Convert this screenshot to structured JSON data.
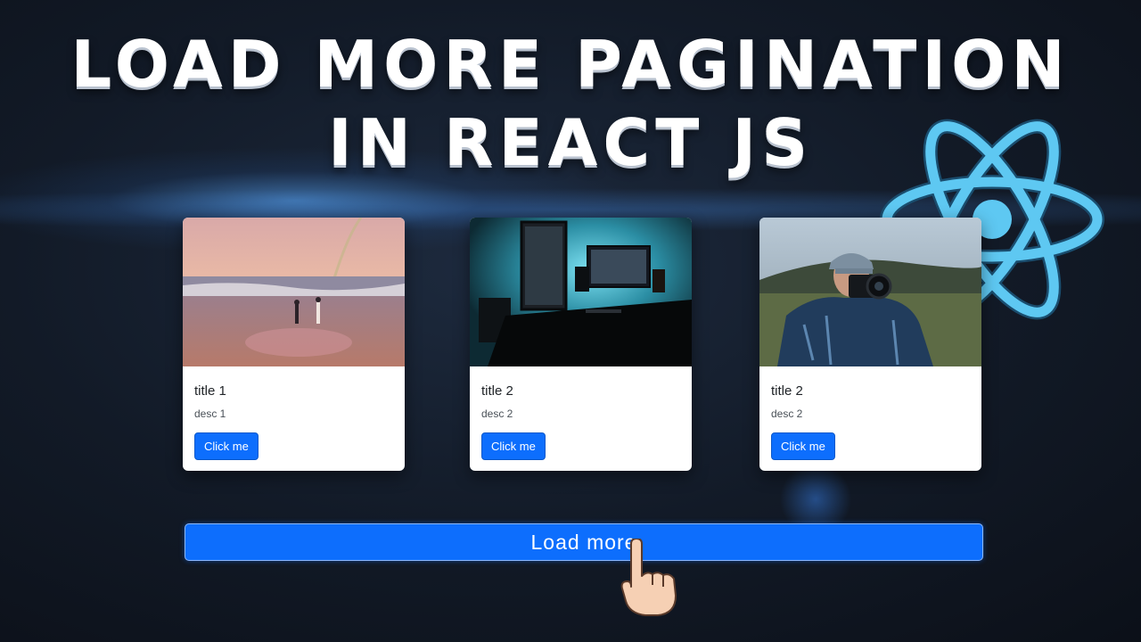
{
  "headline": {
    "line1": "LOAD MORE PAGINATION",
    "line2": "IN REACT JS"
  },
  "cards": [
    {
      "title": "title 1",
      "desc": "desc 1",
      "button_label": "Click me",
      "image": "beach-sunset-couple-photo"
    },
    {
      "title": "title 2",
      "desc": "desc 2",
      "button_label": "Click me",
      "image": "desk-monitor-setup-photo"
    },
    {
      "title": "title 2",
      "desc": "desc 2",
      "button_label": "Click me",
      "image": "photographer-with-camera-photo"
    }
  ],
  "load_more": {
    "label": "Load more"
  },
  "icons": {
    "logo": "react-logo-icon",
    "cursor": "pointing-hand-cursor-icon"
  },
  "colors": {
    "primary_button": "#0d6efd",
    "react_logo": "#5ec8f2",
    "card_background": "#ffffff",
    "page_background": "#0b0f17"
  }
}
